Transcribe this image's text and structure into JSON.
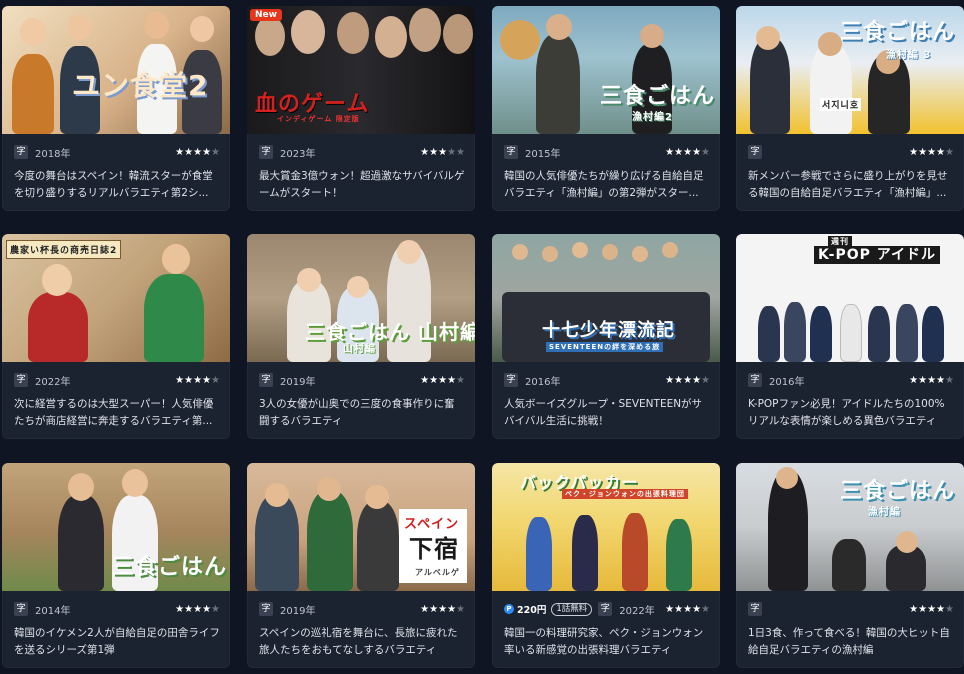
{
  "cards": [
    {
      "title_overlay": "ユン食堂2",
      "badge": "",
      "subtitle": "字",
      "year": "2018年",
      "rating": 4.5,
      "stars": "★★★★★",
      "desc": "今度の舞台はスペイン！韓流スターが食堂を切り盛りするリアルバラエティ第2シ..."
    },
    {
      "title_overlay": "血のゲーム",
      "badge": "New",
      "subtitle": "字",
      "year": "2023年",
      "rating": 3.5,
      "stars": "★★★★★",
      "desc": "最大賞金3億ウォン！超過激なサバイバルゲームがスタート！"
    },
    {
      "title_overlay": "三食ごはん 漁村編2",
      "badge": "",
      "subtitle": "字",
      "year": "2015年",
      "rating": 4.5,
      "stars": "★★★★★",
      "desc": "韓国の人気俳優たちが繰り広げる自給自足バラエティ「漁村編」の第2弾がスター..."
    },
    {
      "title_overlay": "三食ごはん 漁村編3",
      "badge": "",
      "subtitle": "字",
      "year": "",
      "rating": 4.5,
      "stars": "★★★★★",
      "desc": "新メンバー参戦でさらに盛り上がりを見せる韓国の自給自足バラエティ「漁村編」..."
    },
    {
      "title_overlay": "",
      "badge": "",
      "subtitle": "字",
      "year": "2022年",
      "rating": 4.5,
      "stars": "★★★★★",
      "desc": "次に経営するのは大型スーパー！人気俳優たちが商店経営に奔走するバラエティ第..."
    },
    {
      "title_overlay": "三食ごはん 山村編",
      "badge": "",
      "subtitle": "字",
      "year": "2019年",
      "rating": 4.0,
      "stars": "★★★★★",
      "desc": "3人の女優が山奥での三度の食事作りに奮闘するバラエティ"
    },
    {
      "title_overlay": "十七少年漂流記",
      "badge": "",
      "subtitle": "字",
      "year": "2016年",
      "rating": 4.5,
      "stars": "★★★★★",
      "desc": "人気ボーイズグループ・SEVENTEENがサバイバル生活に挑戦！"
    },
    {
      "title_overlay": "週刊 K-POPアイドル",
      "badge": "",
      "subtitle": "字",
      "year": "2016年",
      "rating": 4.5,
      "stars": "★★★★★",
      "desc": "K-POPファン必見！アイドルたちの100%リアルな表情が楽しめる異色バラエティ"
    },
    {
      "title_overlay": "三食ごはん",
      "badge": "",
      "subtitle": "字",
      "year": "2014年",
      "rating": 4.5,
      "stars": "★★★★★",
      "desc": "韓国のイケメン2人が自給自足の田舎ライフを送るシリーズ第1弾"
    },
    {
      "title_overlay": "スペイン下宿",
      "badge": "",
      "subtitle": "字",
      "year": "2019年",
      "rating": 4.5,
      "stars": "★★★★★",
      "desc": "スペインの巡礼宿を舞台に、長旅に疲れた旅人たちをおもてなしするバラエティ"
    },
    {
      "title_overlay": "バックパッカー",
      "badge": "",
      "subtitle": "字",
      "year": "2022年",
      "rating": 4.0,
      "stars": "★★★★★",
      "price": "220円",
      "free": "1話無料",
      "desc": "韓国一の料理研究家、ペク・ジョンウォン率いる新感覚の出張料理バラエティ"
    },
    {
      "title_overlay": "三食ごはん 漁村編",
      "badge": "",
      "subtitle": "字",
      "year": "",
      "rating": 4.5,
      "stars": "★★★★★",
      "desc": "1日3食、作って食べる！韓国の大ヒット自給自足バラエティの漁村編"
    }
  ],
  "overlay_titles": {
    "c3_sub": "漁村編2",
    "c4_sub": "漁村編 3",
    "c6_sub": "山村編",
    "c7_sub": "SEVENTEENの絆を深める旅",
    "c8_top": "週刊",
    "c8_main": "K-POP アイドル",
    "c5_sign": "農家い杯長の商売日誌2",
    "c10_top": "スペイン",
    "c10_main": "下宿",
    "c10_sub": "アルベルゲ",
    "c11_sub": "ペク・ジョンウォンの出張料理団",
    "c2_sub": "インディゲーム 限定版",
    "c4_sign": "서지니호",
    "c12_sub": "漁村編"
  },
  "colors": {
    "page_bg": "#0f1522",
    "card_bg": "#1b2230",
    "new_badge": "#e6371e",
    "coin": "#2f8bf5"
  }
}
